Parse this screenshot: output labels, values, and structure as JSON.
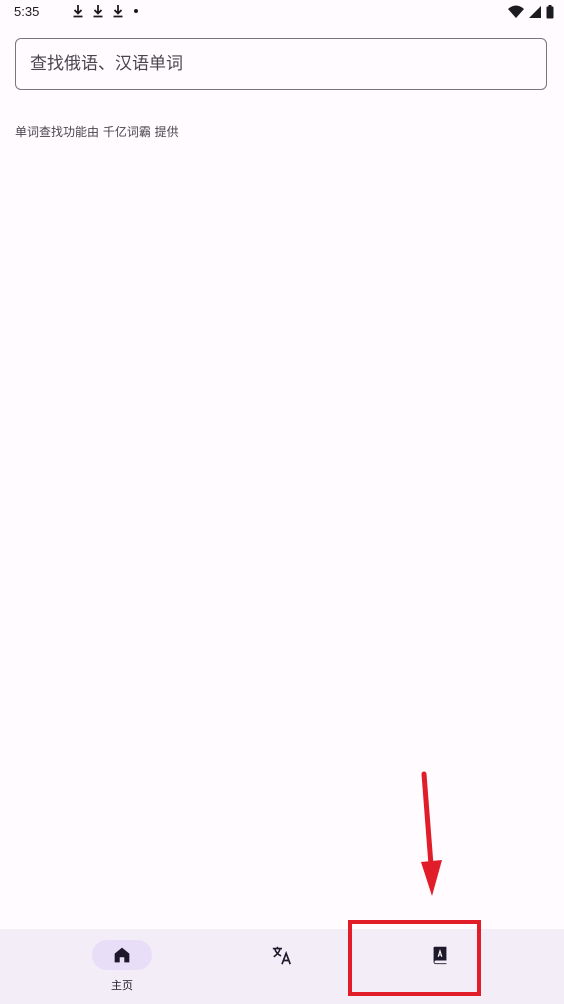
{
  "status_bar": {
    "time": "5:35",
    "left_icons": [
      "download-icon",
      "download-icon",
      "download-icon",
      "dot-icon"
    ],
    "right_icons": [
      "wifi-icon",
      "signal-icon",
      "battery-icon"
    ]
  },
  "search": {
    "placeholder": "查找俄语、汉语单词",
    "value": ""
  },
  "credit_text": "单词查找功能由 千亿词霸 提供",
  "bottom_nav": {
    "items": [
      {
        "icon": "home-icon",
        "label": "主页",
        "active": true
      },
      {
        "icon": "translate-icon",
        "label": "",
        "active": false
      },
      {
        "icon": "dictionary-book-icon",
        "label": "",
        "active": false
      }
    ]
  },
  "annotation": {
    "highlight_color": "#e11d2a",
    "target": "dictionary-book-icon"
  },
  "colors": {
    "background": "#fffbfe",
    "nav_background": "#f3edf7",
    "active_pill": "#e8def8"
  }
}
